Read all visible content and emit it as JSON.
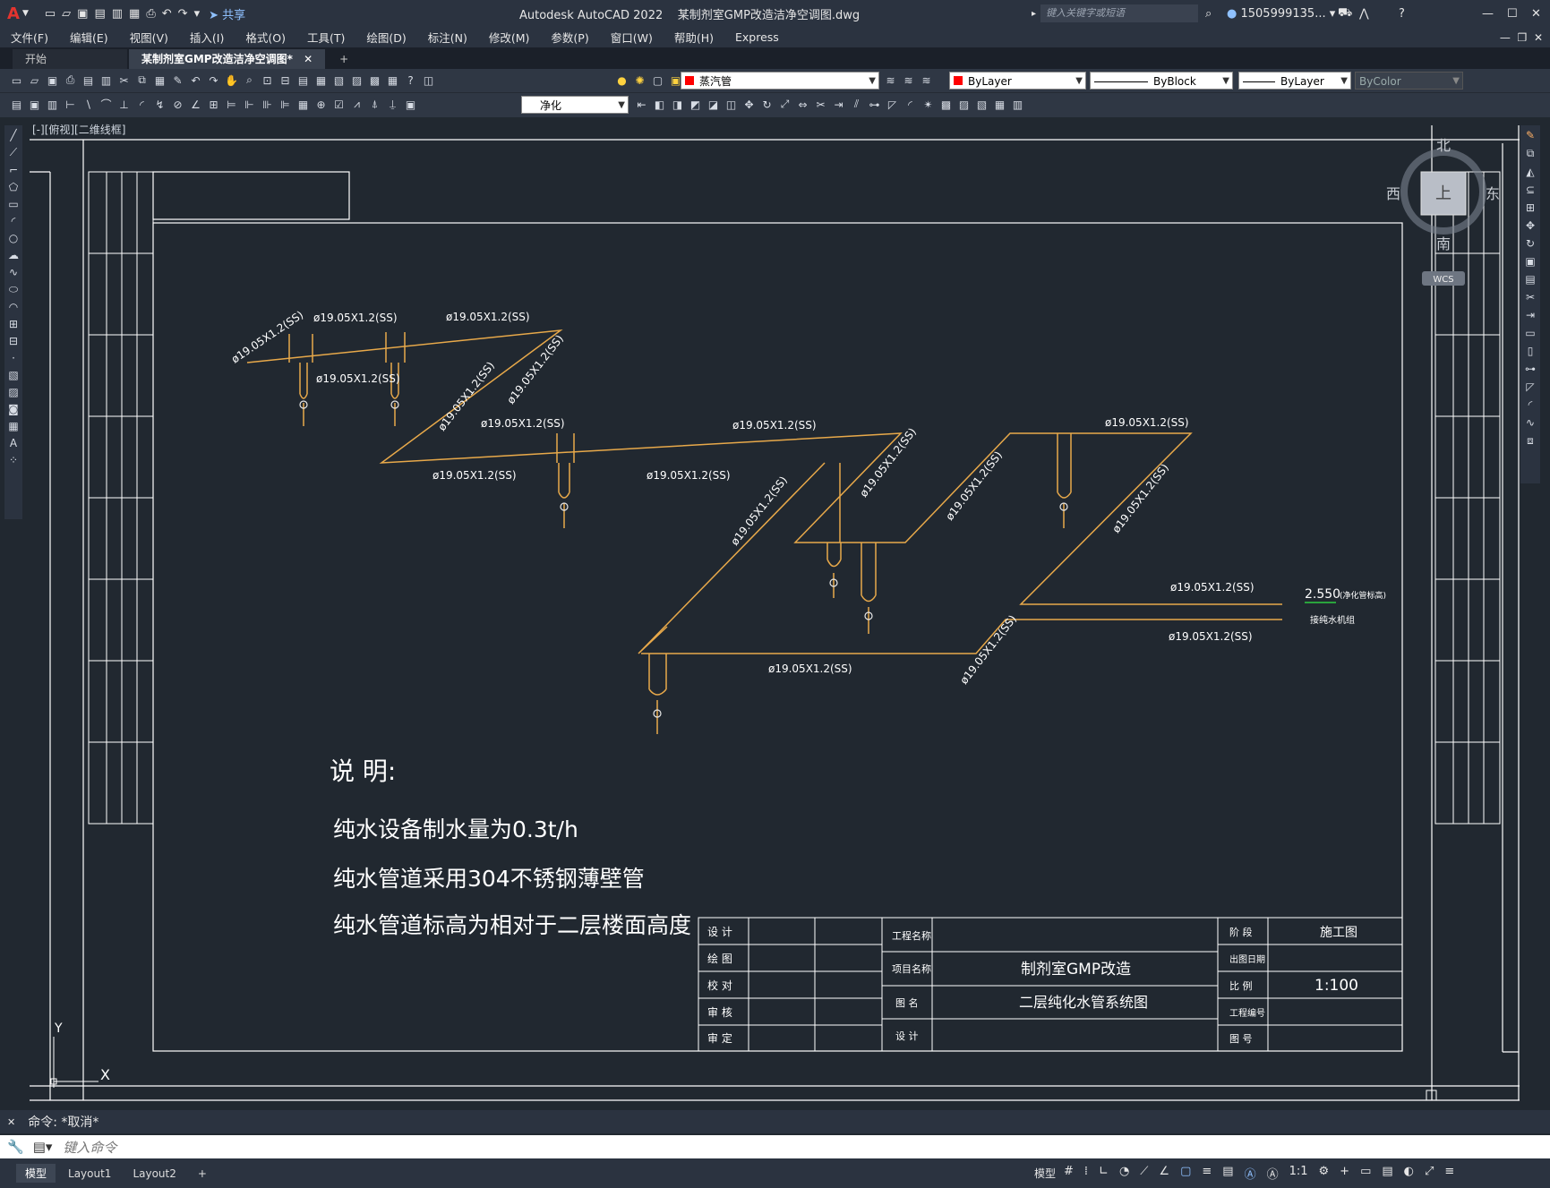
{
  "app": {
    "title": "Autodesk AutoCAD 2022",
    "document": "某制剂室GMP改造洁净空调图.dwg",
    "share_label": "共享",
    "search_placeholder": "键入关键字或短语",
    "user": "1505999135...",
    "brand_color": "#c0282d"
  },
  "menu": [
    "文件(F)",
    "编辑(E)",
    "视图(V)",
    "插入(I)",
    "格式(O)",
    "工具(T)",
    "绘图(D)",
    "标注(N)",
    "修改(M)",
    "参数(P)",
    "窗口(W)",
    "帮助(H)",
    "Express"
  ],
  "tabs": [
    {
      "label": "开始"
    },
    {
      "label": "某制剂室GMP改造洁净空调图*"
    }
  ],
  "properties": {
    "layer": "蒸汽管",
    "color": "ByLayer",
    "linetype": "ByBlock",
    "lineweight": "ByLayer",
    "plotstyle": "ByColor",
    "dimstyle": "净化"
  },
  "viewport_label": "[-][俯视][二维线框]",
  "viewcube": {
    "north": "北",
    "south": "南",
    "east": "东",
    "west": "西",
    "top": "上",
    "wcs": "WCS"
  },
  "drawing": {
    "pipe_labels": {
      "spec": "ø19.05X1.2(SS)",
      "elevation": "2.550",
      "elevation_note": "(净化管标高)",
      "connect_note": "接纯水机组"
    },
    "notes": {
      "heading": "说    明:",
      "lines": [
        "纯水设备制水量为0.3t/h",
        "纯水管道采用304不锈钢薄壁管",
        "纯水管道标高为相对于二层楼面高度"
      ]
    },
    "title_block": {
      "roles": [
        "设 计",
        "绘 图",
        "校 对",
        "审 核",
        "审 定"
      ],
      "project_name_label": "工程名称",
      "item_name_label": "项目名称",
      "drawing_name_label": "图 名",
      "design_label": "设 计",
      "stage_label": "阶 段",
      "stage_value": "施工图",
      "date_label": "出图日期",
      "scale_label": "比 例",
      "scale_value": "1:100",
      "project_no_label": "工程编号",
      "drawing_no_label": "图 号",
      "project_value": "制剂室GMP改造",
      "drawing_value": "二层纯化水管系统图"
    },
    "ucs": {
      "x": "X",
      "y": "Y"
    }
  },
  "command": {
    "last": "命令: *取消*",
    "placeholder": "键入命令"
  },
  "status": {
    "layout_tabs": [
      "模型",
      "Layout1",
      "Layout2"
    ],
    "model_label": "模型",
    "scale": "1:1"
  },
  "colors": {
    "pipe": "#e8a94a",
    "frame": "#ffffff",
    "background": "#212830",
    "layer_swatch": "#ff0000",
    "elev_underline": "#2ecc40"
  }
}
